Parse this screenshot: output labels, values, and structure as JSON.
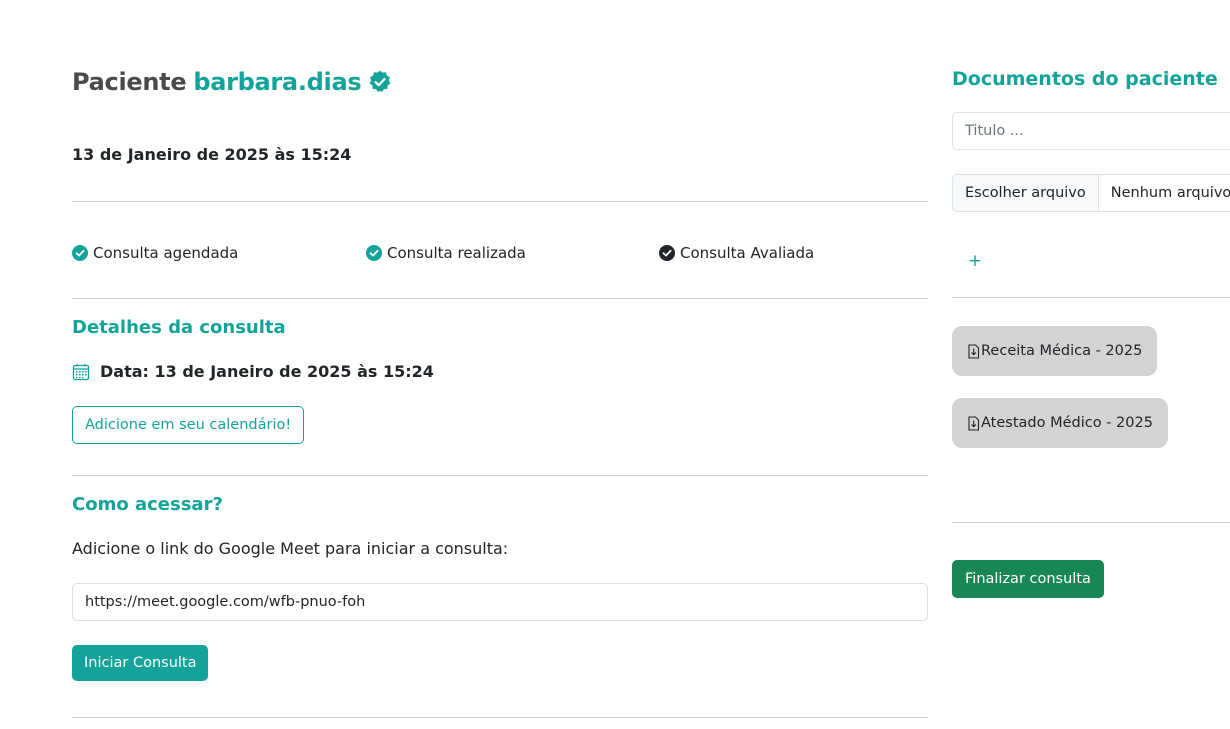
{
  "patient": {
    "label": "Paciente",
    "username": "barbara.dias",
    "verified_icon": "verified-badge-icon"
  },
  "appointment_datetime": "13 de Janeiro de 2025 às 15:24",
  "status_steps": [
    {
      "label": "Consulta agendada",
      "icon": "check-circle-icon",
      "color": "#14a39a"
    },
    {
      "label": "Consulta realizada",
      "icon": "check-circle-icon",
      "color": "#14a39a"
    },
    {
      "label": "Consulta Avaliada",
      "icon": "check-circle-icon",
      "color": "#212529"
    }
  ],
  "details": {
    "title": "Detalhes da consulta",
    "date_text": "Data: 13 de Janeiro de 2025 às 15:24",
    "calendar_icon": "calendar-icon",
    "add_calendar_label": "Adicione em seu calendário!"
  },
  "access": {
    "title": "Como acessar?",
    "instruction": "Adicione o link do Google Meet para iniciar a consulta:",
    "meet_link": "https://meet.google.com/wfb-pnuo-foh",
    "start_label": "Iniciar Consulta"
  },
  "documents": {
    "title": "Documentos do paciente",
    "title_placeholder": "Titulo ...",
    "file_button": "Escolher arquivo",
    "file_status": "Nenhum arquivo escolhido",
    "add_label": "+",
    "items": [
      {
        "label": "Receita Médica - 2025",
        "icon": "download-icon"
      },
      {
        "label": "Atestado Médico - 2025",
        "icon": "download-icon"
      }
    ]
  },
  "finish_label": "Finalizar consulta",
  "colors": {
    "accent": "#14a39a",
    "success": "#198754",
    "chip_bg": "#d3d3d3",
    "divider": "#cfcfcf"
  }
}
